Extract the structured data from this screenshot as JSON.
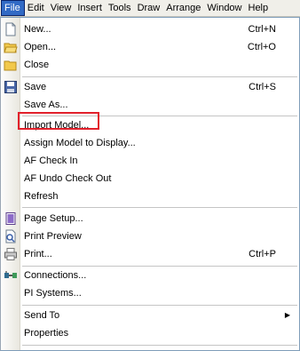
{
  "menubar": {
    "items": [
      "File",
      "Edit",
      "View",
      "Insert",
      "Tools",
      "Draw",
      "Arrange",
      "Window",
      "Help"
    ]
  },
  "file_menu": {
    "new": {
      "label": "New...",
      "shortcut": "Ctrl+N"
    },
    "open": {
      "label": "Open...",
      "shortcut": "Ctrl+O"
    },
    "close": {
      "label": "Close"
    },
    "save": {
      "label": "Save",
      "shortcut": "Ctrl+S"
    },
    "save_as": {
      "label": "Save As..."
    },
    "import_model": {
      "label": "Import Model..."
    },
    "assign_model": {
      "label": "Assign Model to Display..."
    },
    "af_check_in": {
      "label": "AF Check In"
    },
    "af_undo_check_out": {
      "label": "AF Undo Check Out"
    },
    "refresh": {
      "label": "Refresh"
    },
    "page_setup": {
      "label": "Page Setup..."
    },
    "print_preview": {
      "label": "Print Preview"
    },
    "print": {
      "label": "Print...",
      "shortcut": "Ctrl+P"
    },
    "connections": {
      "label": "Connections..."
    },
    "pi_systems": {
      "label": "PI Systems..."
    },
    "send_to": {
      "label": "Send To"
    },
    "properties": {
      "label": "Properties"
    }
  },
  "icons": [
    "new-document-icon",
    "open-folder-icon",
    "close-folder-icon",
    "save-disk-icon",
    "page-setup-icon",
    "print-preview-icon",
    "printer-icon",
    "connections-icon",
    "submenu-arrow-icon"
  ],
  "colors": {
    "active_menu_bg": "#316ac5",
    "highlight_border": "#e2202b"
  }
}
